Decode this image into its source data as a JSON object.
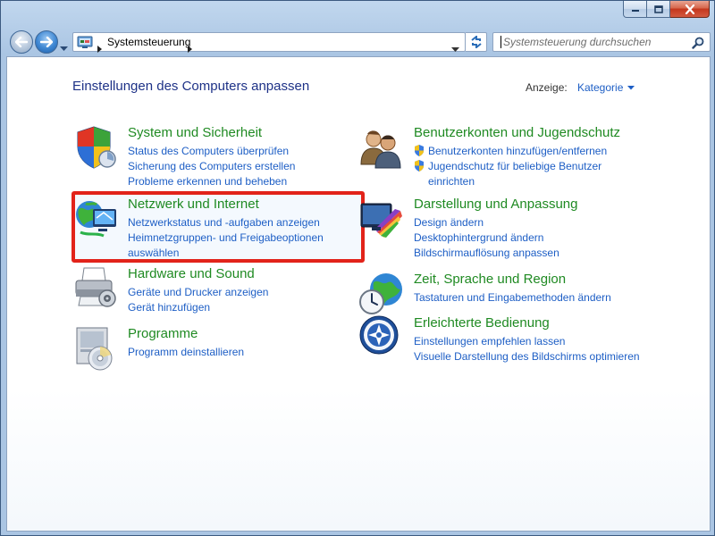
{
  "window": {
    "controls": {
      "minimize": "minimize",
      "maximize": "maximize",
      "close": "close"
    }
  },
  "navbar": {
    "address": {
      "location": "Systemsteuerung"
    },
    "search": {
      "placeholder": "Systemsteuerung durchsuchen"
    }
  },
  "content": {
    "title": "Einstellungen des Computers anpassen",
    "view": {
      "label": "Anzeige:",
      "value": "Kategorie"
    },
    "categories": [
      {
        "title": "System und Sicherheit",
        "icon": "shield-icon",
        "links": [
          "Status des Computers überprüfen",
          "Sicherung des Computers erstellen",
          "Probleme erkennen und beheben"
        ]
      },
      {
        "title": "Netzwerk und Internet",
        "icon": "network-globe-icon",
        "links": [
          "Netzwerkstatus und -aufgaben anzeigen",
          "Heimnetzgruppen- und Freigabeoptionen",
          "auswählen"
        ]
      },
      {
        "title": "Hardware und Sound",
        "icon": "printer-icon",
        "links": [
          "Geräte und Drucker anzeigen",
          "Gerät hinzufügen"
        ]
      },
      {
        "title": "Programme",
        "icon": "programs-disc-icon",
        "links": [
          "Programm deinstallieren"
        ]
      },
      {
        "title": "Benutzerkonten und Jugendschutz",
        "icon": "users-icon",
        "links": [
          "Benutzerkonten hinzufügen/entfernen",
          "Jugendschutz für beliebige Benutzer",
          "einrichten"
        ]
      },
      {
        "title": "Darstellung und Anpassung",
        "icon": "display-color-icon",
        "links": [
          "Design ändern",
          "Desktophintergrund ändern",
          "Bildschirmauflösung anpassen"
        ]
      },
      {
        "title": "Zeit, Sprache und Region",
        "icon": "clock-globe-icon",
        "links": [
          "Tastaturen und Eingabemethoden ändern"
        ]
      },
      {
        "title": "Erleichterte Bedienung",
        "icon": "ease-of-access-icon",
        "links": [
          "Einstellungen empfehlen lassen",
          "Visuelle Darstellung des Bildschirms optimieren"
        ]
      }
    ]
  },
  "colors": {
    "category_title": "#1f8a22",
    "link": "#1d5ec5",
    "page_title": "#1e3287",
    "highlight": "#e2231a"
  }
}
